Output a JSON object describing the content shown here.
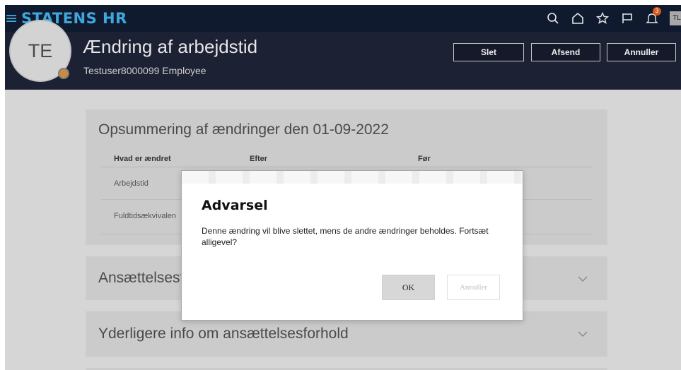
{
  "app": {
    "brand": "STATENS HR",
    "notification_count": "3",
    "user_initials": "TL"
  },
  "header": {
    "avatar_initials": "TE",
    "title": "Ændring af arbejdstid",
    "subtitle": "Testuser8000099 Employee",
    "buttons": {
      "delete": "Slet",
      "send": "Afsend",
      "cancel": "Annuller"
    }
  },
  "summary": {
    "title": "Opsummering af ændringer den 01-09-2022",
    "columns": [
      "Hvad er ændret",
      "Efter",
      "Før"
    ],
    "rows": [
      {
        "label": "Arbejdstid"
      },
      {
        "label": "Fuldtidsækvivalen"
      }
    ]
  },
  "sections": {
    "employment": "Ansættelsesf",
    "more_info": "Yderligere info om ansættelsesforhold"
  },
  "dialog": {
    "title": "Advarsel",
    "message": "Denne ændring vil blive slettet, mens de andre ændringer beholdes. Fortsæt alligevel?",
    "ok_label": "OK",
    "cancel_label": "Annuller"
  },
  "colors": {
    "brand": "#3fa7dc",
    "topbar": "#0f1a2e",
    "header": "#1c2133",
    "badge": "#d65a1c"
  },
  "icons": [
    "hamburger-icon",
    "search-icon",
    "home-icon",
    "star-icon",
    "flag-icon",
    "bell-icon",
    "chevron-down-icon"
  ]
}
